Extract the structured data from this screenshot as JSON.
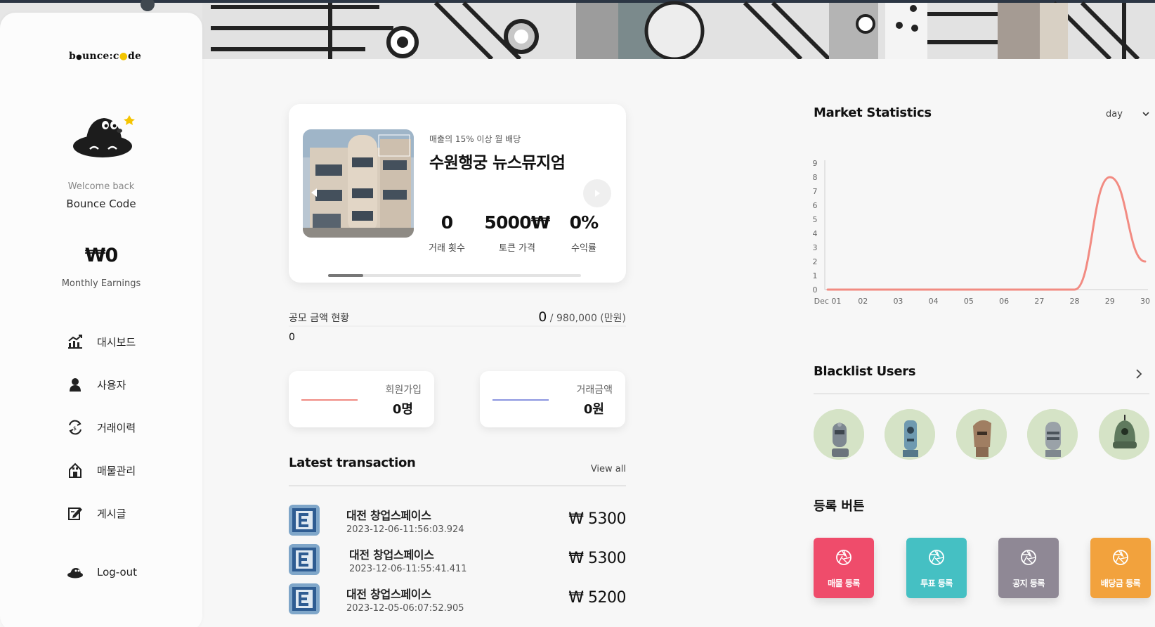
{
  "sidebar": {
    "logo_pre": "b",
    "logo_mid": "unce:c",
    "logo_post": "de",
    "welcome": "Welcome back",
    "username": "Bounce Code",
    "earnings": "₩0",
    "earnings_label": "Monthly Earnings",
    "nav": [
      {
        "label": "대시보드",
        "icon": "chart-icon"
      },
      {
        "label": "사용자",
        "icon": "user-icon"
      },
      {
        "label": "거래이력",
        "icon": "exchange-icon"
      },
      {
        "label": "매물관리",
        "icon": "building-icon"
      },
      {
        "label": "게시글",
        "icon": "edit-icon"
      }
    ],
    "logout": "Log-out"
  },
  "property": {
    "subtitle": "매출의 15% 이상 월 배당",
    "title": "수원행궁 뉴스뮤지엄",
    "stats": [
      {
        "value": "0",
        "label": "거래 횟수"
      },
      {
        "value": "5000₩",
        "label": "토큰 가격"
      },
      {
        "value": "0%",
        "label": "수익률"
      }
    ]
  },
  "fund": {
    "label": "공모 금액 현황",
    "current_big": "0",
    "total": " / 980,000 (만원)",
    "current": "0"
  },
  "mini_cards": [
    {
      "label": "회원가입",
      "value": "0명",
      "color": "#f08a82"
    },
    {
      "label": "거래금액",
      "value": "0원",
      "color": "#8b95e0"
    }
  ],
  "latest": {
    "title": "Latest transaction",
    "view_all": "View all",
    "rows": [
      {
        "name": "대전 창업스페이스",
        "date": "2023-12-06-11:56:03.924",
        "amount": "₩ 5300"
      },
      {
        "name": "대전 창업스페이스",
        "date": "2023-12-06-11:55:41.411",
        "amount": "₩ 5300"
      },
      {
        "name": "대전 창업스페이스",
        "date": "2023-12-05-06:07:52.905",
        "amount": "₩ 5200"
      }
    ]
  },
  "market": {
    "title": "Market Statistics",
    "period": "day"
  },
  "chart_data": {
    "type": "line",
    "x": [
      "Dec 01",
      "02",
      "03",
      "04",
      "05",
      "06",
      "27",
      "28",
      "29",
      "30"
    ],
    "series": [
      {
        "values": [
          0,
          0,
          0,
          0,
          0,
          0,
          0,
          0,
          8,
          2
        ],
        "color": "#f28b82"
      }
    ],
    "yticks": [
      0,
      1,
      2,
      3,
      4,
      5,
      6,
      7,
      8,
      9
    ],
    "ylim": [
      0,
      9
    ]
  },
  "blacklist": {
    "title": "Blacklist Users",
    "avatar_colors": [
      "#d5e3c6",
      "#d5e3c6",
      "#d5e3c6",
      "#d5e3c6",
      "#d5e3c6"
    ]
  },
  "register": {
    "title": "등록 버튼",
    "buttons": [
      {
        "label": "매물 등록",
        "color": "#ef4c6b"
      },
      {
        "label": "투표 등록",
        "color": "#45c0c3"
      },
      {
        "label": "공지 등록",
        "color": "#8f8895"
      },
      {
        "label": "배당금 등록",
        "color": "#f2a23d"
      }
    ]
  }
}
